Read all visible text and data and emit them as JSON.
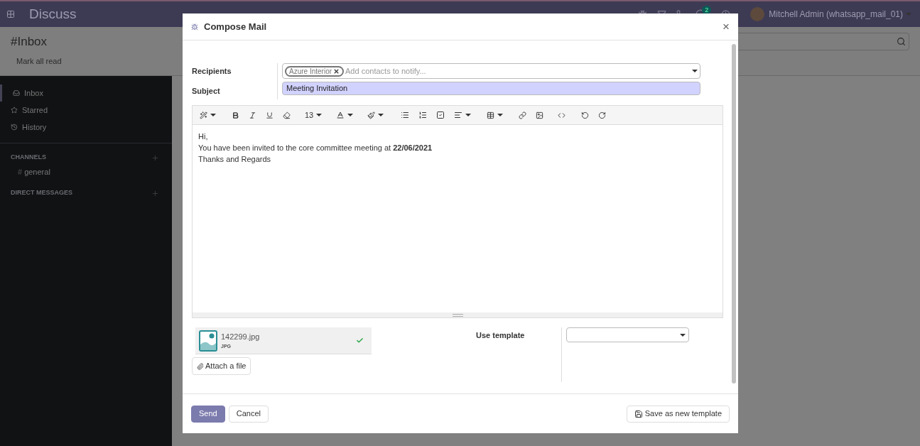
{
  "app": {
    "title": "Discuss",
    "chat_badge": "2",
    "user": "Mitchell Admin (whatsapp_mail_01)"
  },
  "control_panel": {
    "breadcrumb": "#Inbox",
    "buttons": [
      "Mark all read"
    ]
  },
  "sidebar": {
    "mailboxes": [
      {
        "kind": "inbox",
        "label": "Inbox",
        "selected": true
      },
      {
        "kind": "starred",
        "label": "Starred",
        "selected": false
      },
      {
        "kind": "history",
        "label": "History",
        "selected": false
      }
    ],
    "sections": [
      {
        "title": "CHANNELS",
        "items": [
          {
            "prefix": "#",
            "label": "general"
          }
        ]
      },
      {
        "title": "DIRECT MESSAGES"
      }
    ]
  },
  "dialog": {
    "title": "Compose Mail",
    "close": "×",
    "recipients": {
      "label": "Recipients",
      "tags": [
        "Azure Interior"
      ],
      "placeholder": "Add contacts to notify..."
    },
    "subject": {
      "label": "Subject",
      "value": "Meeting Invitation"
    },
    "toolbar": {
      "font_size": "13"
    },
    "body": [
      "Hi,",
      "You have been invited to the core committee meeting at **22/06/2021**",
      "Thanks and Regards"
    ],
    "attachments": [
      {
        "name": "142299.jpg",
        "type": "JPG",
        "uploaded": true
      }
    ],
    "attach_button": "Attach a file",
    "template": {
      "label": "Use template"
    },
    "buttons": [
      {
        "kind": "primary",
        "label": "Send"
      },
      {
        "kind": "secondary",
        "label": "Cancel"
      },
      {
        "kind": "save",
        "label": "Save as new template"
      }
    ]
  }
}
